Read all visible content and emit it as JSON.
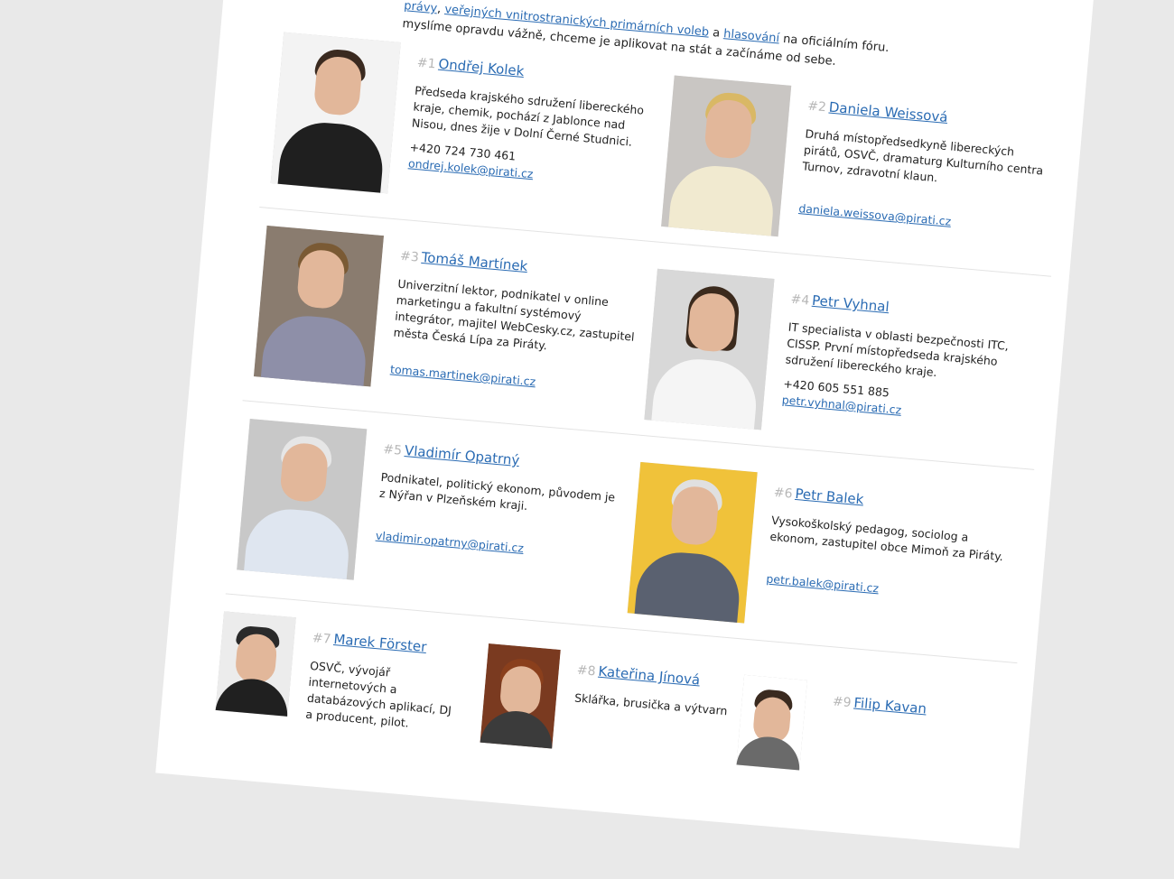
{
  "intro": {
    "line1_links": [
      "právy",
      "veřejných vnitrostranických primárních voleb",
      "hlasování"
    ],
    "line1_parts": [
      ",",
      "a",
      "na oficiálním fóru."
    ],
    "line2": "myslíme opravdu vážně, chceme je aplikovat na stát a začínáme od sebe."
  },
  "candidates": [
    {
      "rank": "#1",
      "name": "Ondřej Kolek",
      "desc": "Předseda krajského sdružení libereckého kraje, chemik, pochází z Jablonce nad Nisou, dnes žije v Dolní Černé Studnici.",
      "phone": "+420 724 730 461",
      "email": "ondrej.kolek@pirati.cz"
    },
    {
      "rank": "#2",
      "name": "Daniela Weissová",
      "desc": "Druhá místopředsedkyně libereckých pirátů, OSVČ, dramaturg Kulturního centra Turnov, zdravotní klaun.",
      "phone": "",
      "email": "daniela.weissova@pirati.cz"
    },
    {
      "rank": "#3",
      "name": "Tomáš Martínek",
      "desc": "Univerzitní lektor, podnikatel v online marketingu a fakultní systémový integrátor, majitel WebCesky.cz, zastupitel města Česká Lípa za Piráty.",
      "phone": "",
      "email": "tomas.martinek@pirati.cz"
    },
    {
      "rank": "#4",
      "name": "Petr Vyhnal",
      "desc": "IT specialista v oblasti bezpečnosti ITC, CISSP. První místopředseda krajského sdružení libereckého kraje.",
      "phone": "+420 605 551 885",
      "email": "petr.vyhnal@pirati.cz"
    },
    {
      "rank": "#5",
      "name": "Vladimír Opatrný",
      "desc": "Podnikatel, politický ekonom, původem je z Nýřan v Plzeňském kraji.",
      "phone": "",
      "email": "vladimir.opatrny@pirati.cz"
    },
    {
      "rank": "#6",
      "name": "Petr Balek",
      "desc": "Vysokoškolský pedagog, sociolog a ekonom, zastupitel obce Mimoň za Piráty.",
      "phone": "",
      "email": "petr.balek@pirati.cz"
    },
    {
      "rank": "#7",
      "name": "Marek Förster",
      "desc": "OSVČ, vývojář internetových a databázových aplikací, DJ a producent, pilot.",
      "phone": "",
      "email": ""
    },
    {
      "rank": "#8",
      "name": "Kateřina Jínová",
      "desc": "Sklářka, brusička a výtvarn",
      "phone": "",
      "email": ""
    },
    {
      "rank": "#9",
      "name": "Filip Kavan",
      "desc": "",
      "phone": "",
      "email": ""
    }
  ],
  "colors": {
    "link": "#2a6bb3",
    "rank": "#b7b7b7",
    "text": "#222222"
  }
}
